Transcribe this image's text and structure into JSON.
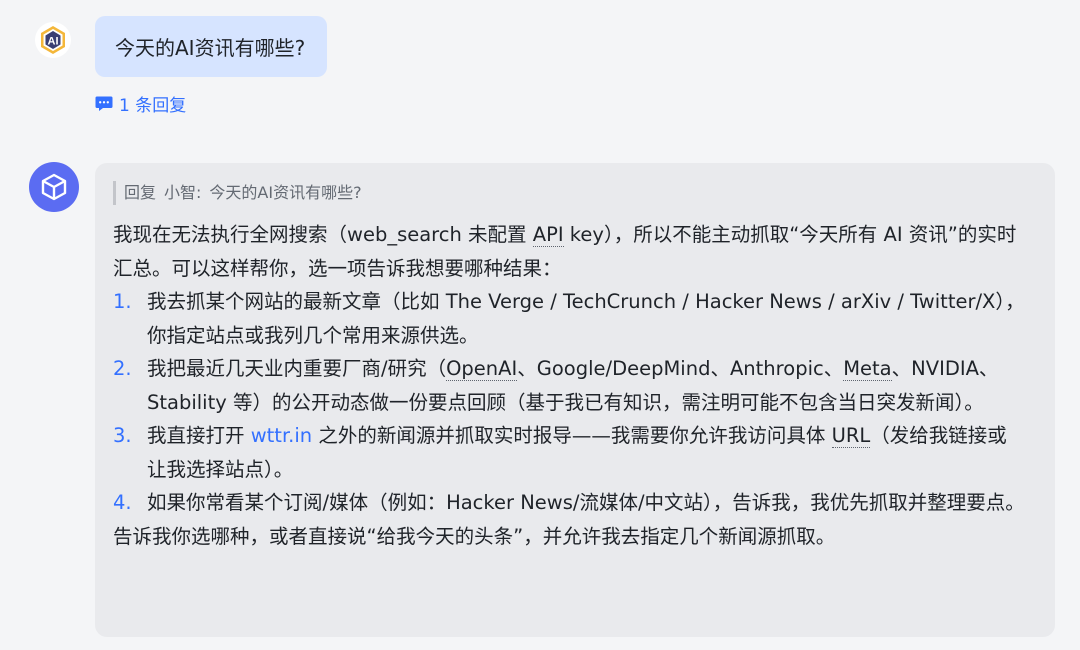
{
  "user_message": {
    "avatar_text": "AI",
    "text": "今天的AI资讯有哪些?",
    "reply_count_label": "1 条回复"
  },
  "bot_reply": {
    "quote_prefix": "回复",
    "quote_author": "小智:",
    "quote_text": "今天的AI资讯有哪些?",
    "intro": {
      "a": "我现在无法执行全网搜索（web_search 未配置 ",
      "api": "API",
      "b": " key），所以不能主动抓取“今天所有 AI 资讯”的实时汇总。可以这样帮你，选一项告诉我想要哪种结果："
    },
    "options": [
      {
        "num": "1.",
        "text": "我去抓某个网站的最新文章（比如 The Verge / TechCrunch / Hacker News / arXiv / Twitter/X），你指定站点或我列几个常用来源供选。"
      },
      {
        "num": "2.",
        "a": "我把最近几天业内重要厂商/研究（",
        "openai": "OpenAI",
        "b": "、Google/DeepMind、Anthropic、",
        "meta": "Meta",
        "c": "、NVIDIA、Stability 等）的公开动态做一份要点回顾（基于我已有知识，需注明可能不包含当日突发新闻）。"
      },
      {
        "num": "3.",
        "a": "我直接打开 ",
        "link": "wttr.in",
        "b": " 之外的新闻源并抓取实时报导——我需要你允许我访问具体 ",
        "url": "URL",
        "c": "（发给我链接或让我选择站点）。"
      },
      {
        "num": "4.",
        "text": "如果你常看某个订阅/媒体（例如：Hacker News/流媒体/中文站），告诉我，我优先抓取并整理要点。"
      }
    ],
    "closing": "告诉我你选哪种，或者直接说“给我今天的头条”，并允许我去指定几个新闻源抓取。"
  },
  "colors": {
    "accent": "#3370ff",
    "user_bubble": "#d6e4ff",
    "bot_card": "#e9eaed",
    "bot_avatar": "#5b6cf2"
  },
  "icons": [
    "ai-logo-icon",
    "comment-icon",
    "cube-icon"
  ]
}
